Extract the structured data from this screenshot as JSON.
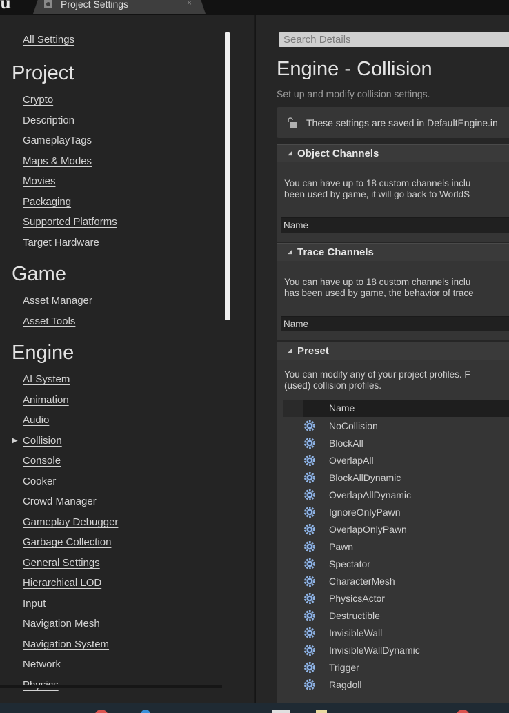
{
  "window": {
    "tab_label": "Project Settings",
    "close_glyph": "×"
  },
  "sidebar": {
    "all_settings": "All Settings",
    "project": {
      "heading": "Project",
      "items": [
        "Crypto",
        "Description",
        "GameplayTags",
        "Maps & Modes",
        "Movies",
        "Packaging",
        "Supported Platforms",
        "Target Hardware"
      ]
    },
    "game": {
      "heading": "Game",
      "items": [
        "Asset Manager",
        "Asset Tools"
      ]
    },
    "engine": {
      "heading": "Engine",
      "items": [
        "AI System",
        "Animation",
        "Audio",
        "Collision",
        "Console",
        "Cooker",
        "Crowd Manager",
        "Gameplay Debugger",
        "Garbage Collection",
        "General Settings",
        "Hierarchical LOD",
        "Input",
        "Navigation Mesh",
        "Navigation System",
        "Network",
        "Physics"
      ],
      "selected": "Collision"
    }
  },
  "main": {
    "search_placeholder": "Search Details",
    "title": "Engine - Collision",
    "subtitle": "Set up and modify collision settings.",
    "notice": "These settings are saved in DefaultEngine.in",
    "object_channels": {
      "header": "Object Channels",
      "text_line1": "You can have up to 18 custom channels inclu",
      "text_line2": "been used by game, it will go back to WorldS",
      "name_col": "Name"
    },
    "trace_channels": {
      "header": "Trace Channels",
      "text_line1": "You can have up to 18 custom channels inclu",
      "text_line2": "has been used by game, the behavior of trace",
      "name_col": "Name"
    },
    "preset": {
      "header": "Preset",
      "text_line1": "You can modify any of your project profiles. F",
      "text_line2": "(used) collision profiles.",
      "name_col": "Name",
      "profiles": [
        "NoCollision",
        "BlockAll",
        "OverlapAll",
        "BlockAllDynamic",
        "OverlapAllDynamic",
        "IgnoreOnlyPawn",
        "OverlapOnlyPawn",
        "Pawn",
        "Spectator",
        "CharacterMesh",
        "PhysicsActor",
        "Destructible",
        "InvisibleWall",
        "InvisibleWallDynamic",
        "Trigger",
        "Ragdoll"
      ]
    }
  },
  "colors": {
    "sidebar_bg": "#242424",
    "panel_bg": "#262626",
    "section_header": "#3a3a3a",
    "gear_blue": "#8fb4e6"
  }
}
